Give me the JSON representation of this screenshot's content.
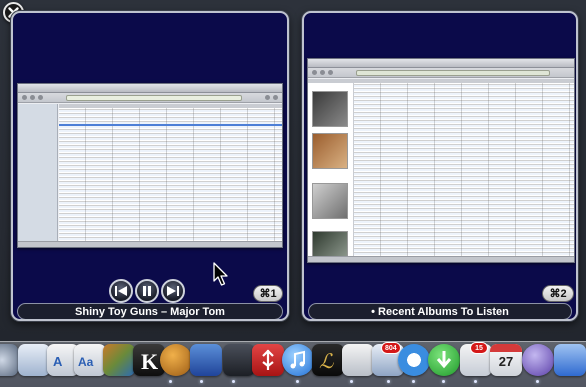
{
  "window1": {
    "title": "Shiny Toy Guns – Major Tom",
    "shortcut": "⌘1"
  },
  "window2": {
    "title": "• Recent Albums To Listen",
    "shortcut": "⌘2"
  },
  "controls": [
    {
      "icon": "previous-track-icon"
    },
    {
      "icon": "pause-icon"
    },
    {
      "icon": "next-track-icon"
    }
  ],
  "dock": {
    "badges": {
      "mail": "804",
      "ical": "15"
    },
    "calendar_day": "27"
  },
  "colors": {
    "panel_bg": "#0b0a4a",
    "dock_badge": "#d41818"
  }
}
